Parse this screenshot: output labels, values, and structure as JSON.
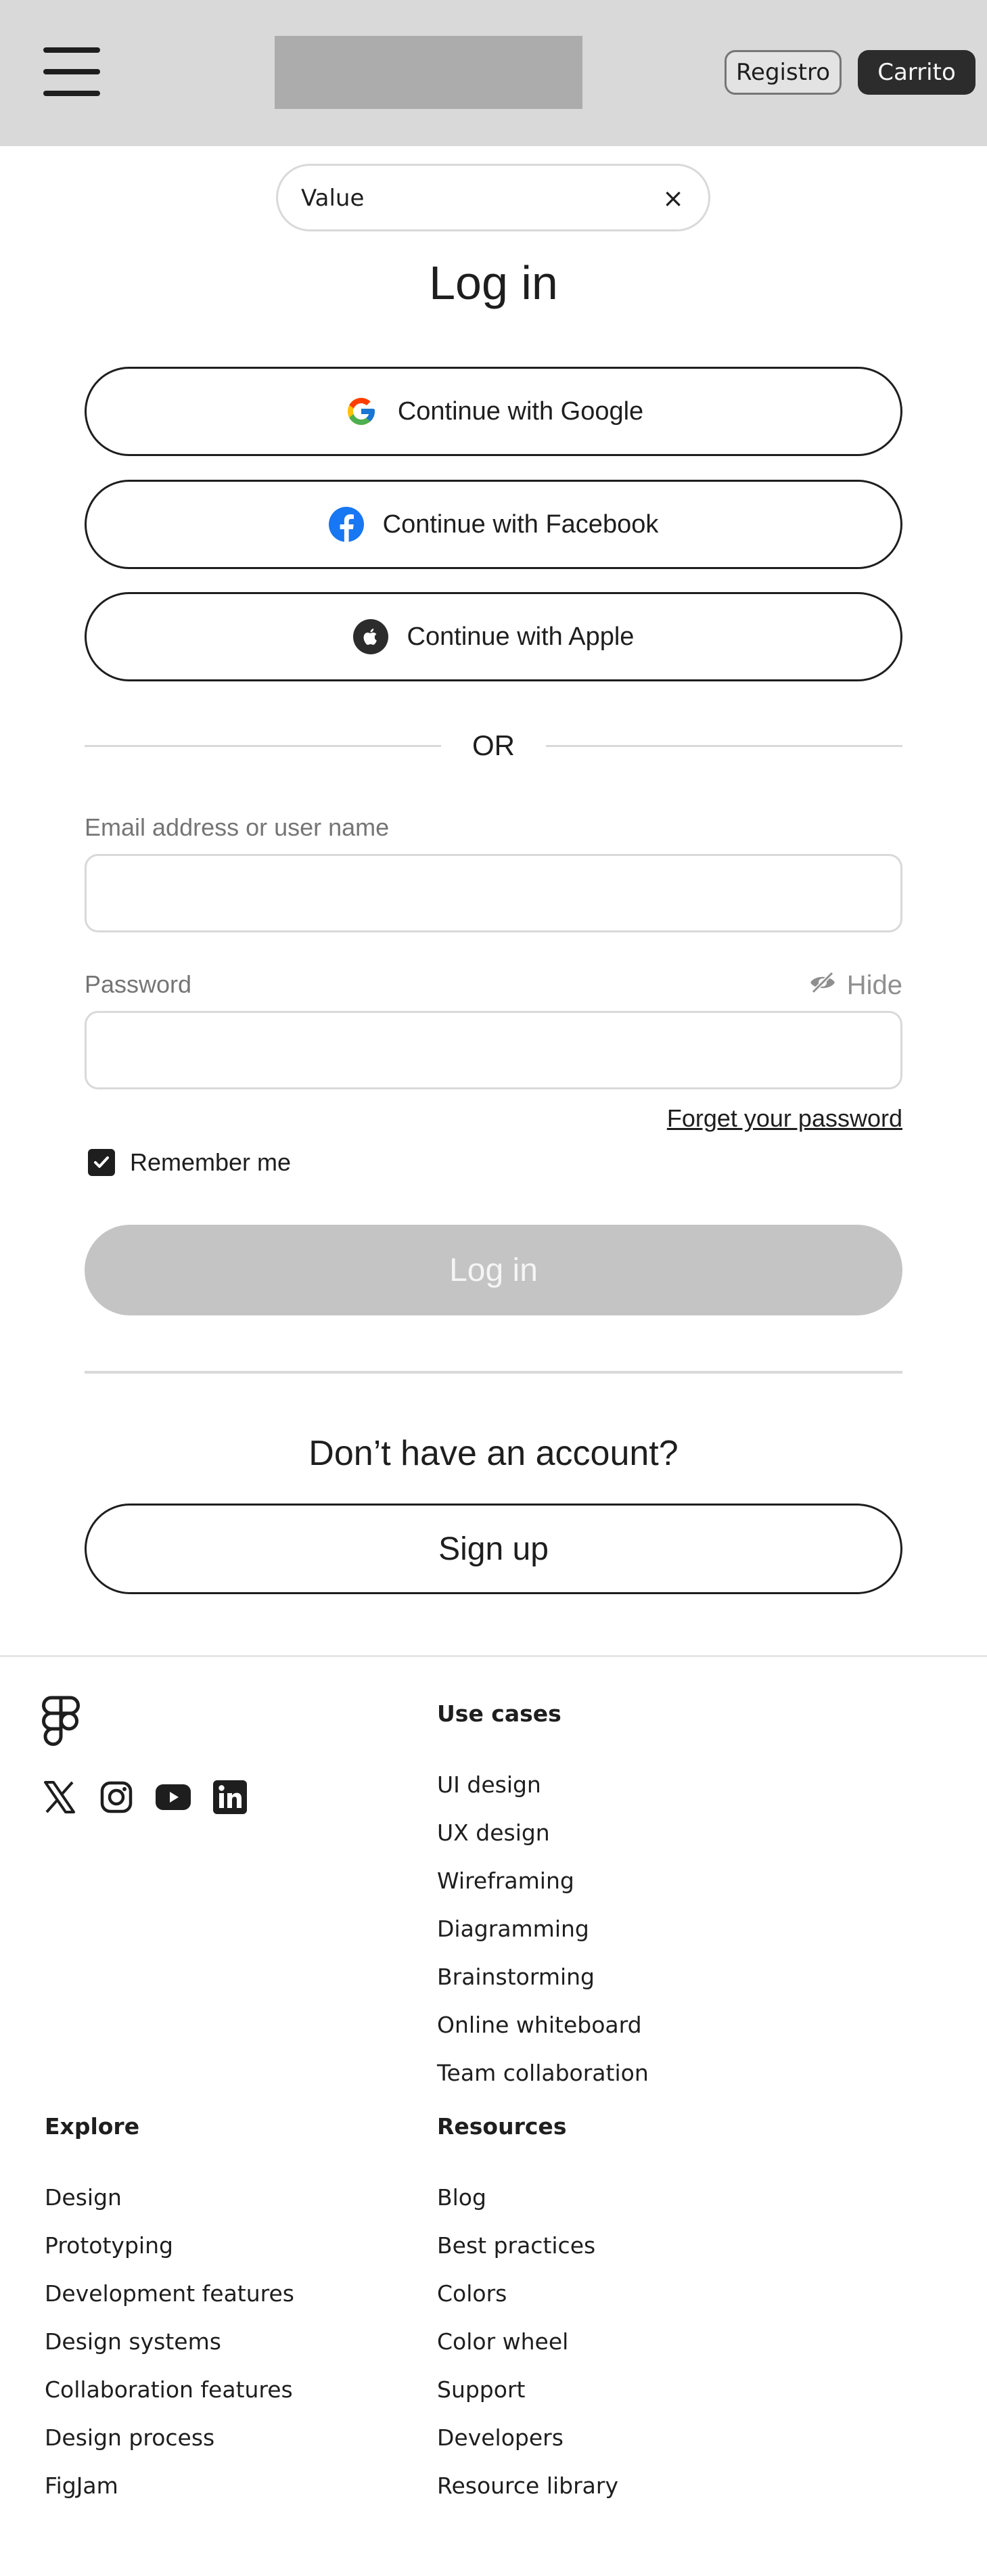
{
  "header": {
    "registro_label": "Registro",
    "carrito_label": "Carrito"
  },
  "search": {
    "value": "Value",
    "clear_icon": "×"
  },
  "title": "Log in",
  "social": {
    "google_label": "Continue with Google",
    "facebook_label": "Continue with Facebook",
    "apple_label": "Continue with Apple"
  },
  "or_text": "OR",
  "form": {
    "email_label": "Email address or user name",
    "password_label": "Password",
    "hide_label": "Hide",
    "forgot_label": "Forget your password",
    "remember_label": "Remember me",
    "login_label": "Log in"
  },
  "signup": {
    "prompt": "Don’t have an account?",
    "button_label": "Sign up"
  },
  "footer": {
    "use_cases": {
      "title": "Use cases",
      "items": [
        "UI design",
        "UX design",
        "Wireframing",
        "Diagramming",
        "Brainstorming",
        "Online whiteboard",
        "Team collaboration"
      ]
    },
    "explore": {
      "title": "Explore",
      "items": [
        "Design",
        "Prototyping",
        "Development features",
        "Design systems",
        "Collaboration features",
        "Design process",
        "FigJam"
      ]
    },
    "resources": {
      "title": "Resources",
      "items": [
        "Blog",
        "Best practices",
        "Colors",
        "Color wheel",
        "Support",
        "Developers",
        "Resource library"
      ]
    },
    "social_icons": [
      "x-icon",
      "instagram-icon",
      "youtube-icon",
      "linkedin-icon"
    ]
  },
  "colors": {
    "header_bg": "#d9d9d9",
    "facebook_blue": "#1877f2",
    "disabled_button": "#c4c4c4",
    "dark": "#1e1e1e"
  }
}
